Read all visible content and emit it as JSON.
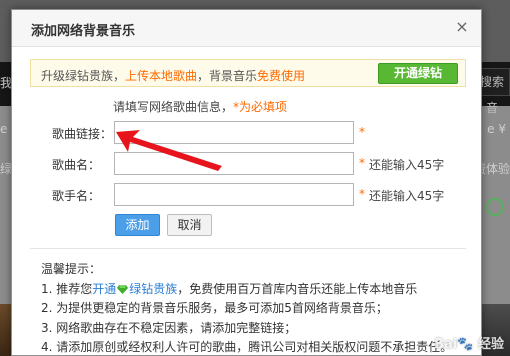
{
  "background": {
    "left_fragment_nav": "我的",
    "search_fragment": "搜索音",
    "left_fragment_row1": "e",
    "left_fragment_row2": "绿钻",
    "right_fragment_row1": "e ¥",
    "right_fragment_row2": "费体验"
  },
  "dialog": {
    "title": "添加网络背景音乐",
    "close_label": "×"
  },
  "notice": {
    "prefix": "升级绿钻贵族，",
    "upload_link": "上传本地歌曲",
    "middle": "，背景音乐",
    "free_link": "免费使用",
    "button_label": "开通绿钻"
  },
  "form": {
    "hint": "请填写网络歌曲信息，",
    "hint_required": "*为必填项",
    "link_label": "歌曲链接：",
    "link_value": "",
    "name_label": "歌曲名：",
    "name_value": "",
    "name_tip": "还能输入45字",
    "singer_label": "歌手名：",
    "singer_value": "",
    "singer_tip": "还能输入45字",
    "required_mark": "*",
    "add_button": "添加",
    "cancel_button": "取消"
  },
  "tips": {
    "title": "温馨提示：",
    "line1_prefix": "1. 推荐您",
    "line1_link": "开通",
    "line1_link2": "绿钻贵族",
    "line1_suffix": "，免费使用百万首库内音乐还能上传本地音乐",
    "line2": "2. 为提供更稳定的背景音乐服务，最多可添加5首网络背景音乐；",
    "line3": "3. 网络歌曲存在不稳定因素，请添加完整链接；",
    "line4": "4. 请添加原创或经权利人许可的歌曲，腾讯公司对相关版权问题不承担责任。"
  },
  "watermark": "Bai🐾 经验",
  "colors": {
    "accent_orange": "#ff6a00",
    "green_button": "#58b834",
    "blue_button": "#4a9fe8",
    "link_blue": "#2a7fd4",
    "arrow_red": "#e8141c"
  },
  "icons": {
    "close": "close-icon",
    "gem": "green-diamond-icon",
    "arrow": "red-arrow-annotation"
  }
}
